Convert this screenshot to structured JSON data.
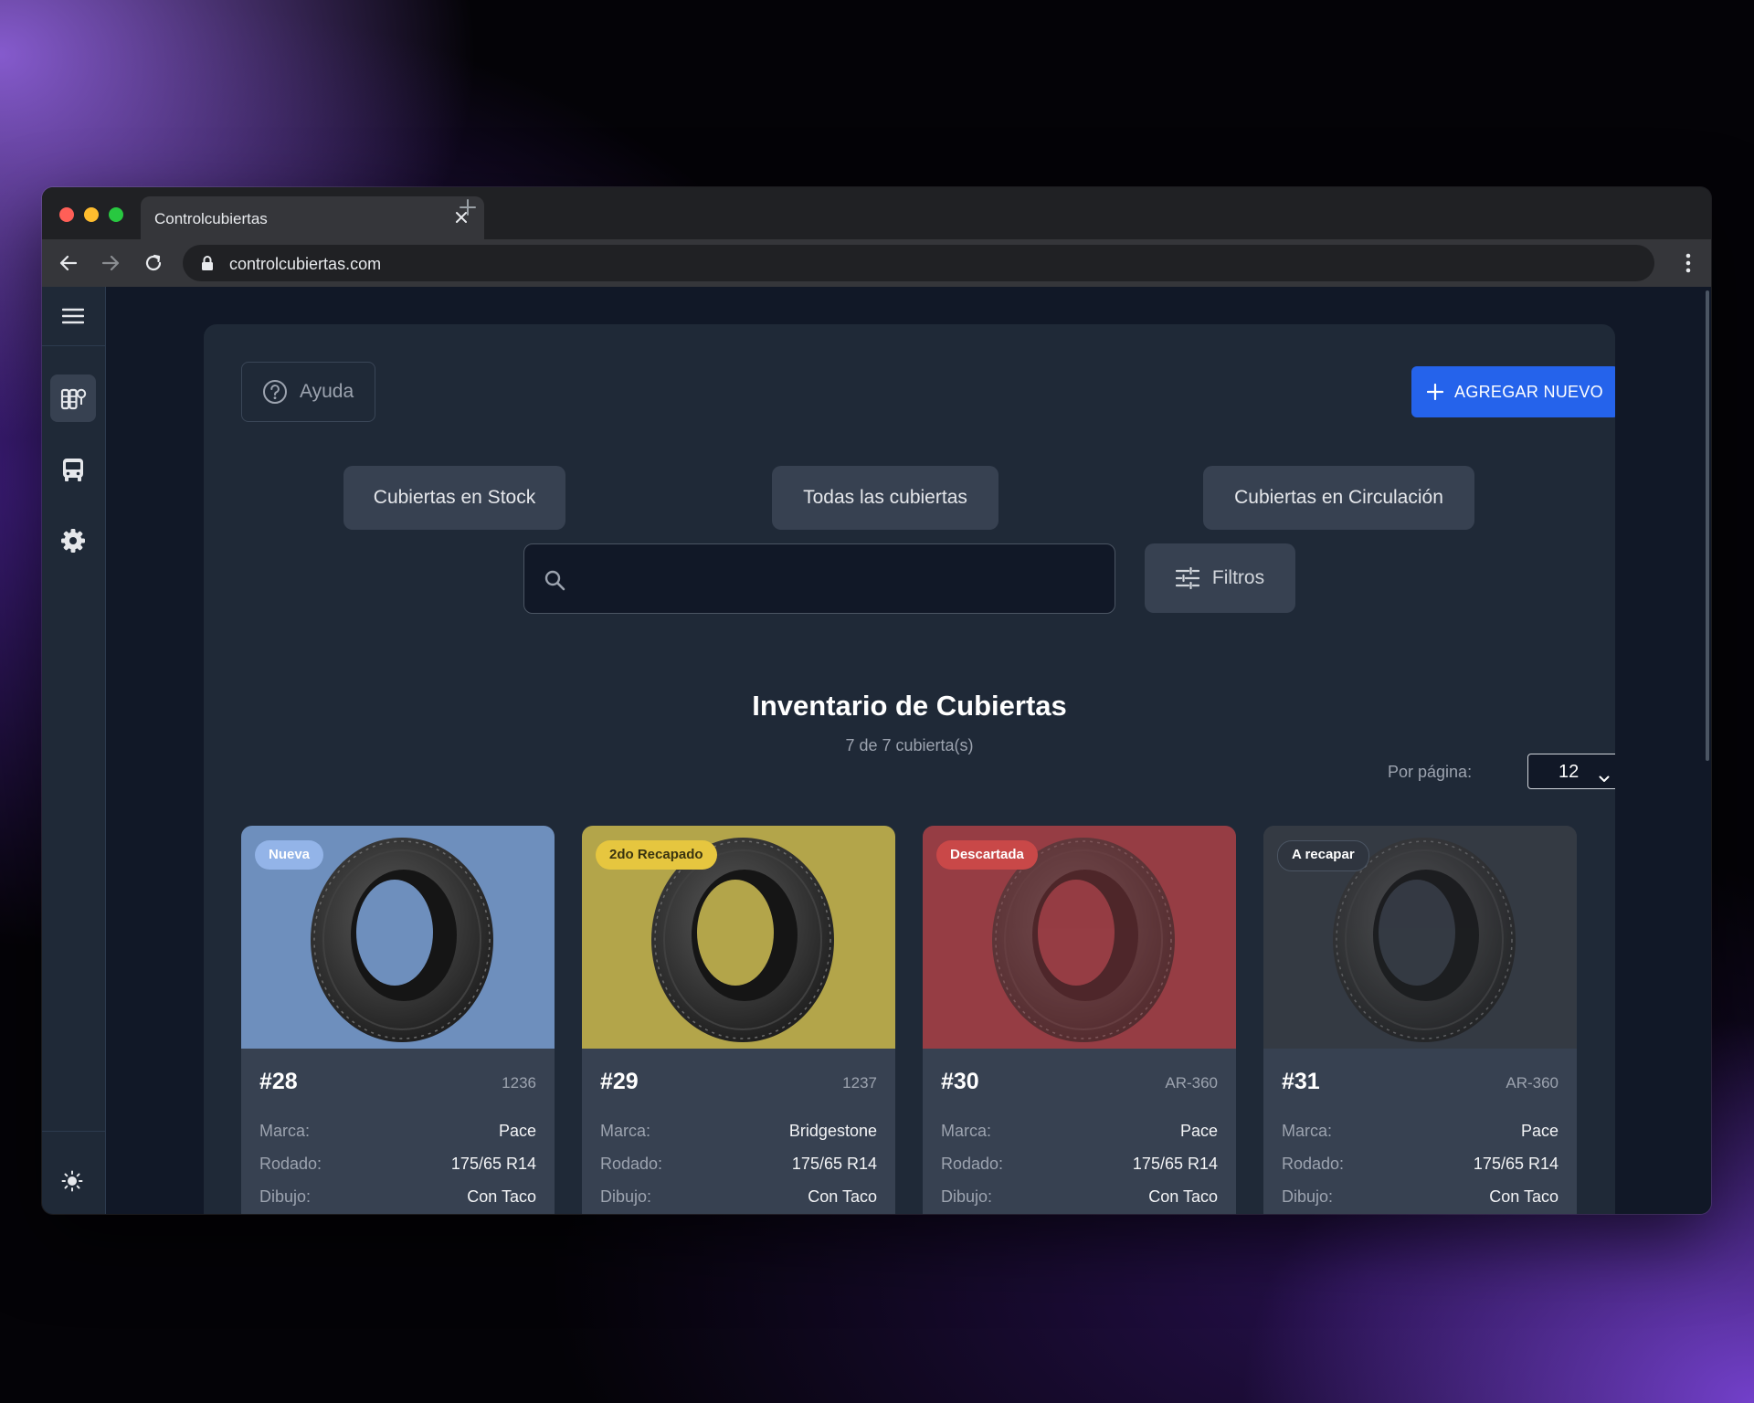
{
  "browser": {
    "tab_title": "Controlcubiertas",
    "url": "controlcubiertas.com"
  },
  "sidebar": {
    "items": [
      {
        "icon": "tire-inventory-icon",
        "active": true
      },
      {
        "icon": "bus-icon",
        "active": false
      },
      {
        "icon": "gear-icon",
        "active": false
      }
    ],
    "theme_icon": "sun-icon"
  },
  "header": {
    "help_label": "Ayuda",
    "add_label": "AGREGAR NUEVO"
  },
  "segments": {
    "stock": "Cubiertas en Stock",
    "all": "Todas las cubiertas",
    "circulation": "Cubiertas en Circulación"
  },
  "search": {
    "placeholder": "",
    "value": ""
  },
  "filters_label": "Filtros",
  "inventory": {
    "title": "Inventario de Cubiertas",
    "count": "7 de 7 cubierta(s)",
    "per_page_label": "Por página:",
    "per_page_value": "12"
  },
  "cards": [
    {
      "badge": "Nueva",
      "badge_color": "#93b4e8",
      "bg_color": "#6e8fbd",
      "number": "#28",
      "code": "1236",
      "rows": [
        {
          "label": "Marca:",
          "value": "Pace"
        },
        {
          "label": "Rodado:",
          "value": "175/65 R14"
        },
        {
          "label": "Dibujo:",
          "value": "Con Taco"
        }
      ]
    },
    {
      "badge": "2do Recapado",
      "badge_color": "#e6c63f",
      "bg_color": "#b3a54a",
      "number": "#29",
      "code": "1237",
      "rows": [
        {
          "label": "Marca:",
          "value": "Bridgestone"
        },
        {
          "label": "Rodado:",
          "value": "175/65 R14"
        },
        {
          "label": "Dibujo:",
          "value": "Con Taco"
        }
      ]
    },
    {
      "badge": "Descartada",
      "badge_color": "#c94848",
      "bg_color": "#963d44",
      "number": "#30",
      "code": "AR-360",
      "rows": [
        {
          "label": "Marca:",
          "value": "Pace"
        },
        {
          "label": "Rodado:",
          "value": "175/65 R14"
        },
        {
          "label": "Dibujo:",
          "value": "Con Taco"
        }
      ]
    },
    {
      "badge": "A recapar",
      "badge_color": "#2f353f",
      "bg_color": "#343a43",
      "number": "#31",
      "code": "AR-360",
      "rows": [
        {
          "label": "Marca:",
          "value": "Pace"
        },
        {
          "label": "Rodado:",
          "value": "175/65 R14"
        },
        {
          "label": "Dibujo:",
          "value": "Con Taco"
        }
      ]
    }
  ]
}
